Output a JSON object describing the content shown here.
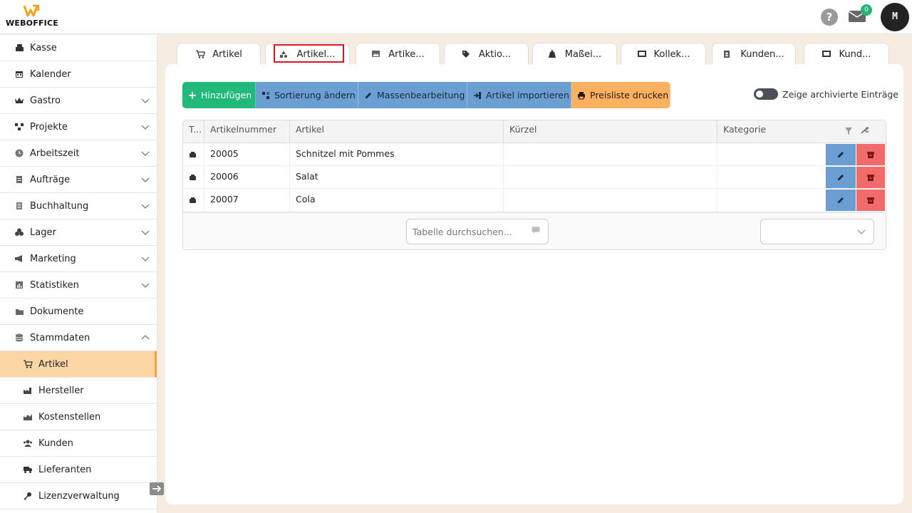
{
  "brand": {
    "name": "WEBOFFICE"
  },
  "header": {
    "help_label": "?",
    "mail_count": "0",
    "avatar_initial": "M"
  },
  "sidebar": {
    "items": [
      {
        "label": "Kasse",
        "icon": "register-icon"
      },
      {
        "label": "Kalender",
        "icon": "calendar-icon"
      },
      {
        "label": "Gastro",
        "icon": "crown-icon"
      },
      {
        "label": "Projekte",
        "icon": "projects-icon"
      },
      {
        "label": "Arbeitszeit",
        "icon": "clock-icon"
      },
      {
        "label": "Aufträge",
        "icon": "document-icon"
      },
      {
        "label": "Buchhaltung",
        "icon": "ledger-icon"
      },
      {
        "label": "Lager",
        "icon": "warehouse-icon"
      },
      {
        "label": "Marketing",
        "icon": "megaphone-icon"
      },
      {
        "label": "Statistiken",
        "icon": "chart-icon"
      },
      {
        "label": "Dokumente",
        "icon": "folder-icon"
      },
      {
        "label": "Stammdaten",
        "icon": "database-icon"
      }
    ],
    "sub_items": [
      {
        "label": "Artikel",
        "icon": "cart-icon"
      },
      {
        "label": "Hersteller",
        "icon": "factory-icon"
      },
      {
        "label": "Kostenstellen",
        "icon": "cost-chart-icon"
      },
      {
        "label": "Kunden",
        "icon": "users-icon"
      },
      {
        "label": "Lieferanten",
        "icon": "truck-icon"
      },
      {
        "label": "Lizenzverwaltung",
        "icon": "key-icon"
      }
    ]
  },
  "tabs": [
    {
      "label": "Artikel",
      "icon": "cart-icon"
    },
    {
      "label": "Artikel...",
      "icon": "shapes-icon"
    },
    {
      "label": "Artike...",
      "icon": "image-icon"
    },
    {
      "label": "Aktio...",
      "icon": "tag-icon"
    },
    {
      "label": "Maßei...",
      "icon": "weight-icon"
    },
    {
      "label": "Kollek...",
      "icon": "collection-icon"
    },
    {
      "label": "Kunden...",
      "icon": "id-card-icon"
    },
    {
      "label": "Kund...",
      "icon": "card-icon"
    }
  ],
  "toolbar": {
    "add": "Hinzufügen",
    "sort": "Sortierung ändern",
    "bulk_edit": "Massenbearbeitung",
    "import": "Artikel importieren",
    "print": "Preisliste drucken",
    "archived_toggle": "Zeige archivierte Einträge"
  },
  "table": {
    "columns": [
      "T...",
      "Artikelnummer",
      "Artikel",
      "Kürzel",
      "Kategorie"
    ],
    "rows": [
      {
        "number": "20005",
        "name": "Schnitzel mit Pommes",
        "short": "",
        "category": ""
      },
      {
        "number": "20006",
        "name": "Salat",
        "short": "",
        "category": ""
      },
      {
        "number": "20007",
        "name": "Cola",
        "short": "",
        "category": ""
      }
    ],
    "search_placeholder": "Tabelle durchsuchen...",
    "page_size_value": ""
  },
  "colors": {
    "accent": "#f0a43f",
    "add": "#21b97a",
    "blue": "#6b9fd4",
    "orange": "#fbb15f",
    "danger": "#f26b6b"
  }
}
